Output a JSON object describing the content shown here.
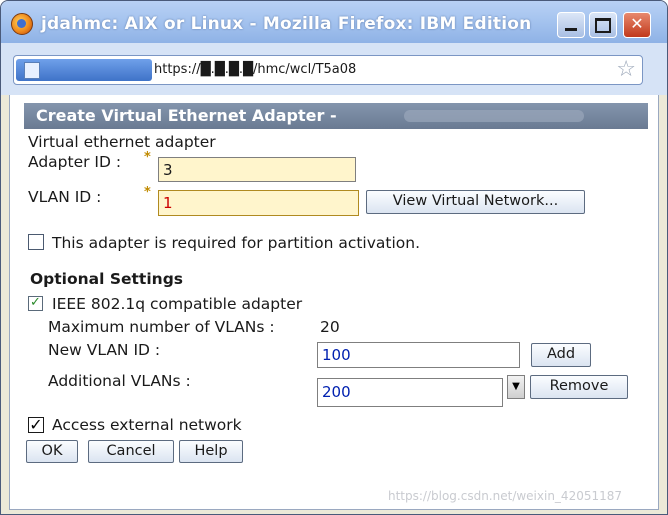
{
  "window": {
    "title": "jdahmc: AIX or Linux - Mozilla Firefox: IBM Edition",
    "controls": {
      "minimize": "",
      "maximize": "",
      "close": "✕"
    }
  },
  "browser": {
    "url": "https://█.█.█.█/hmc/wcl/T5a08"
  },
  "dialog": {
    "title": "Create Virtual Ethernet Adapter -",
    "section_label": "Virtual ethernet adapter",
    "adapter_id_label": "Adapter ID :",
    "adapter_id_value": "3",
    "vlan_id_label": "VLAN ID :",
    "vlan_id_value": "1",
    "required_marker": "*",
    "view_virtual_network_label": "View Virtual Network...",
    "required_for_activation_label": "This adapter is required for partition activation.",
    "required_for_activation_checked": false,
    "optional_settings_heading": "Optional Settings",
    "ieee_label": "IEEE 802.1q compatible adapter",
    "ieee_checked": true,
    "max_vlans_label": "Maximum number of VLANs :",
    "max_vlans_value": "20",
    "new_vlan_id_label": "New VLAN ID :",
    "new_vlan_id_value": "100",
    "add_label": "Add",
    "additional_vlans_label": "Additional VLANs :",
    "additional_vlans_selected": "200",
    "remove_label": "Remove",
    "access_external_label": "Access external network",
    "access_external_checked": true,
    "ok_label": "OK",
    "cancel_label": "Cancel",
    "help_label": "Help",
    "check_mark": "✓",
    "check_mark_bold": "☑"
  },
  "watermark": "https://blog.csdn.net/weixin_42051187",
  "colors": {
    "header_bar": "#7485a0",
    "input_highlight": "#fff5cc",
    "error_text": "#cc0000",
    "value_text": "#0020b0",
    "required_star": "#c08a00"
  }
}
